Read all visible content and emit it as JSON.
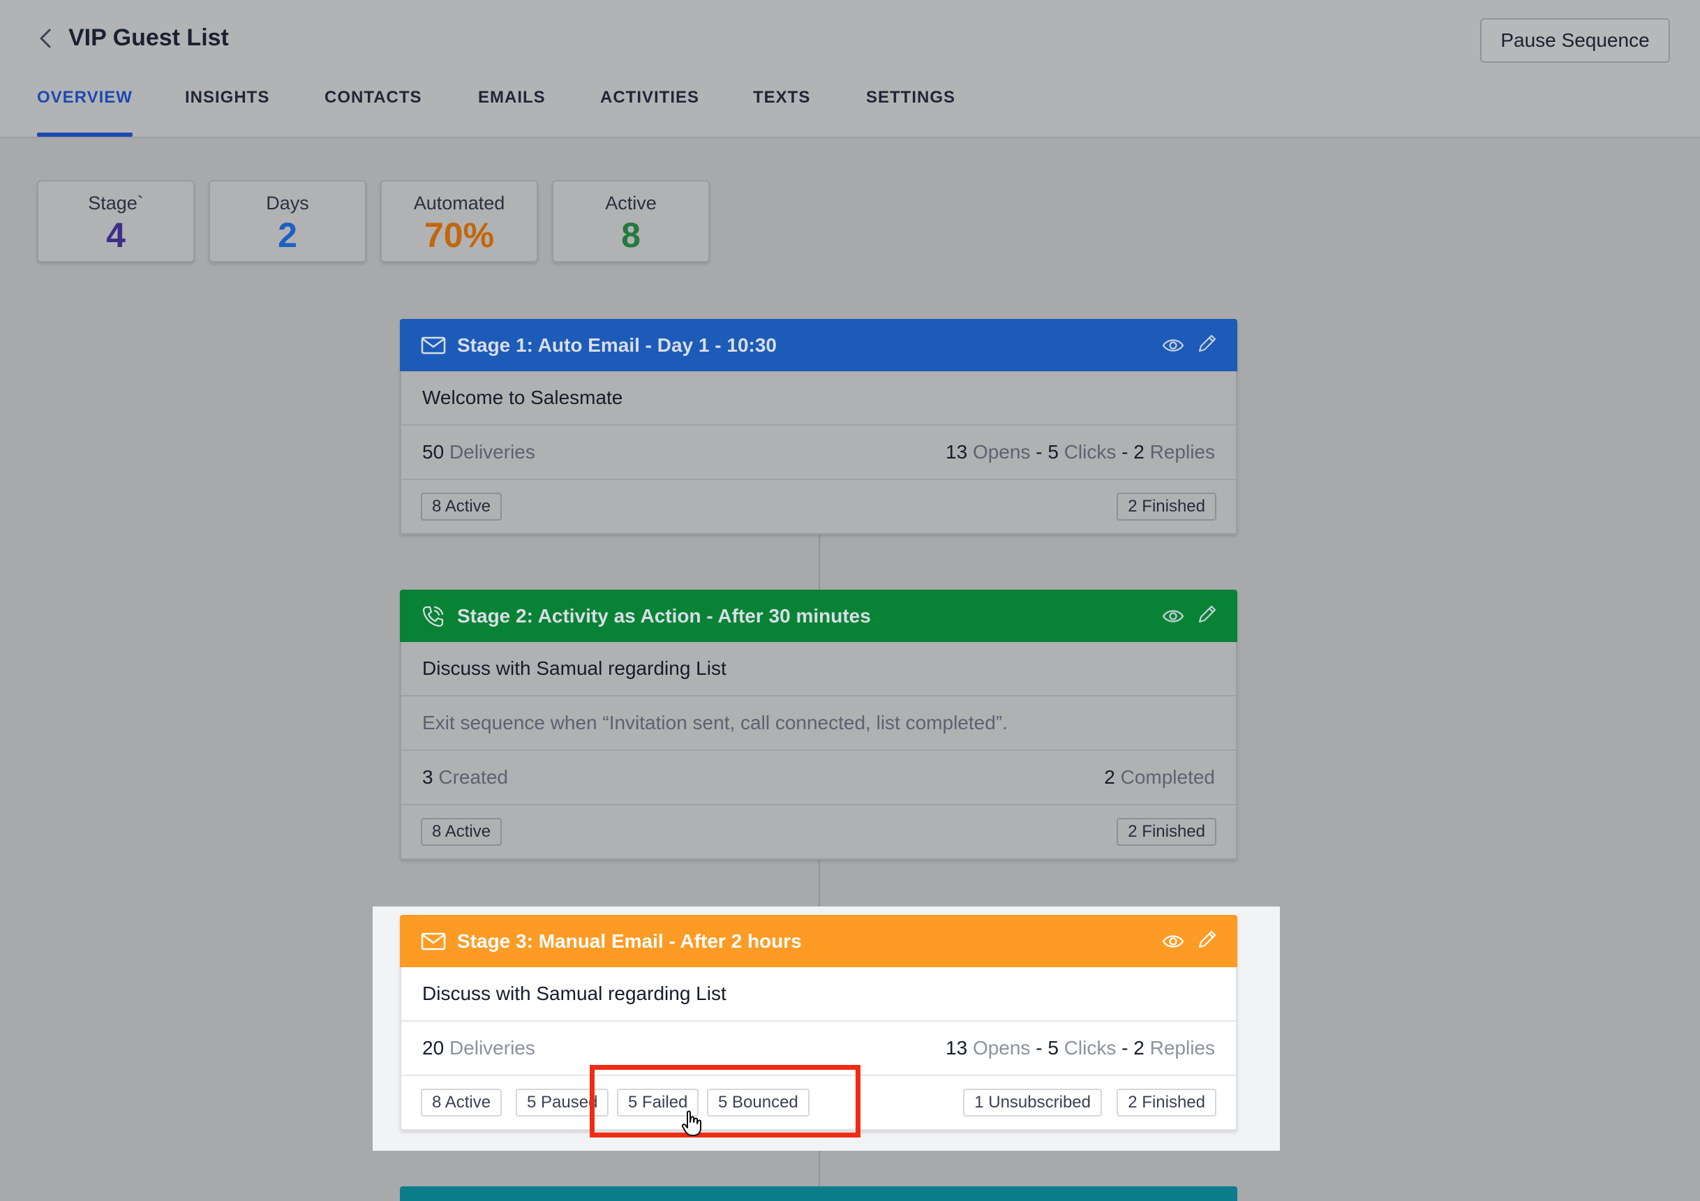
{
  "header": {
    "title": "VIP Guest List",
    "pause_label": "Pause Sequence",
    "tabs": [
      "OVERVIEW",
      "INSIGHTS",
      "CONTACTS",
      "EMAILS",
      "ACTIVITIES",
      "TEXTS",
      "SETTINGS"
    ],
    "active_tab": "OVERVIEW"
  },
  "stats": [
    {
      "label": "Stage`",
      "value": "4",
      "color": "#3e2e8a"
    },
    {
      "label": "Days",
      "value": "2",
      "color": "#1f5fc2"
    },
    {
      "label": "Automated",
      "value": "70%",
      "color": "#c2670d"
    },
    {
      "label": "Active",
      "value": "8",
      "color": "#237a3c"
    }
  ],
  "stages": [
    {
      "title": "Stage 1: Auto Email - Day 1 - 10:30",
      "icon": "envelope-icon",
      "color": "#1c5bb8",
      "subject": "Welcome to Salesmate",
      "deliveries": {
        "count": "50",
        "label": "Deliveries"
      },
      "opens": {
        "count": "13",
        "label": "Opens"
      },
      "clicks": {
        "count": "5",
        "label": "Clicks"
      },
      "replies": {
        "count": "2",
        "label": "Replies"
      },
      "sep": "-",
      "tags_left": [
        "8 Active"
      ],
      "tags_right": [
        "2 Finished"
      ]
    },
    {
      "title": "Stage 2: Activity as Action - After 30 minutes",
      "icon": "phone-icon",
      "color": "#088335",
      "subject": "Discuss with Samual regarding List",
      "exit_text": "Exit sequence when “Invitation sent, call connected, list completed”.",
      "created": {
        "count": "3",
        "label": "Created"
      },
      "completed": {
        "count": "2",
        "label": "Completed"
      },
      "tags_left": [
        "8 Active"
      ],
      "tags_right": [
        "2 Finished"
      ]
    },
    {
      "title": "Stage 3: Manual Email - After 2 hours",
      "icon": "envelope-icon",
      "color": "#fd9b25",
      "subject": "Discuss with Samual regarding List",
      "deliveries": {
        "count": "20",
        "label": "Deliveries"
      },
      "opens": {
        "count": "13",
        "label": "Opens"
      },
      "clicks": {
        "count": "5",
        "label": "Clicks"
      },
      "replies": {
        "count": "2",
        "label": "Replies"
      },
      "sep": "-",
      "tags_left": [
        "8 Active",
        "5 Paused",
        "5 Failed",
        "5 Bounced"
      ],
      "tags_right": [
        "1 Unsubscribed",
        "2 Finished"
      ]
    }
  ],
  "stage4_color": "#0b7d8c"
}
